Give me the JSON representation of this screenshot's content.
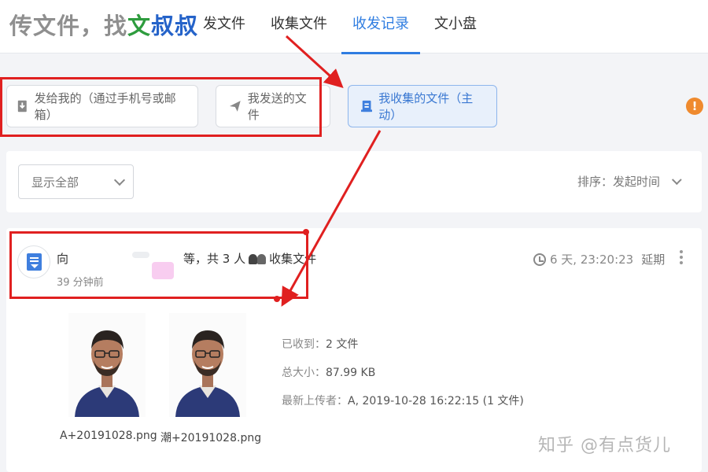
{
  "header": {
    "logo": {
      "part1": "传文件",
      "part2": "，找",
      "part3": "文",
      "part4": "叔叔"
    },
    "nav": [
      "发文件",
      "收集文件",
      "收发记录",
      "文小盘"
    ],
    "active_nav": "收发记录"
  },
  "filter_buttons": {
    "sent_to_me": "发给我的（通过手机号或邮箱）",
    "my_sent": "我发送的文件",
    "my_collected": "我收集的文件（主动）"
  },
  "filter_panel": {
    "select_value": "显示全部",
    "sort_label": "排序：发起时间"
  },
  "record": {
    "to_label": "向",
    "summary_text": "等，共 3 人",
    "summary_action": "收集文件",
    "time_ago": "39 分钟前",
    "deadline": "6 天, 23:20:23",
    "extend_label": "延期",
    "files": [
      {
        "name": "A+20191028.png"
      },
      {
        "name": "潮+20191028.png"
      }
    ],
    "stats": {
      "received_label": "已收到：",
      "received_value": "2 文件",
      "size_label": "总大小：",
      "size_value": "87.99 KB",
      "uploader_label": "最新上传者：",
      "uploader_value": "A, 2019-10-28 16:22:15 (1 文件)"
    }
  },
  "watermark": "知乎 @有点货儿",
  "colors": {
    "accent": "#2f7de1",
    "annotation": "#e02020",
    "logo_green": "#2e9c3e",
    "logo_blue": "#2563c9",
    "warning": "#ef8a2e"
  }
}
